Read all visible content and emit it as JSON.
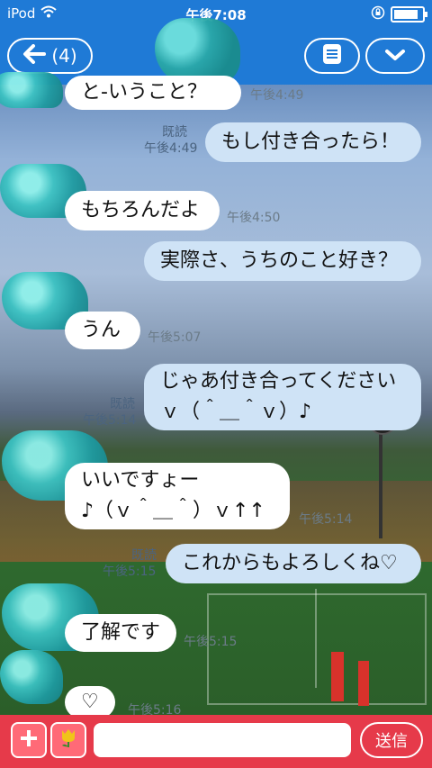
{
  "status": {
    "device": "iPod",
    "time": "午後7:08"
  },
  "header": {
    "back_count": "(4)"
  },
  "messages": [
    {
      "dir": "in",
      "text": "と-いうこと？",
      "time": "午後4:49",
      "read": ""
    },
    {
      "dir": "out",
      "text": "もし付き合ったら！",
      "time": "午後4:49",
      "read": "既読"
    },
    {
      "dir": "in",
      "text": "もちろんだよ",
      "time": "午後4:50",
      "read": ""
    },
    {
      "dir": "out",
      "text": "実際さ、うちのこと好き？",
      "time": "",
      "read": ""
    },
    {
      "dir": "in",
      "text": "うん",
      "time": "午後5:07",
      "read": ""
    },
    {
      "dir": "out",
      "text": "じゃあ付き合ってください\nｖ（＾＿＾ｖ）♪",
      "time": "午後5:14",
      "read": "既読"
    },
    {
      "dir": "in",
      "text": "いいですょー\n♪（ｖ＾＿＾）ｖ↑↑",
      "time": "午後5:14",
      "read": ""
    },
    {
      "dir": "out",
      "text": "これからもよろしくね♡",
      "time": "午後5:15",
      "read": "既読"
    },
    {
      "dir": "in",
      "text": "了解です",
      "time": "午後5:15",
      "read": ""
    },
    {
      "dir": "in",
      "text": "♡",
      "time": "午後5:16",
      "read": ""
    }
  ],
  "input": {
    "placeholder": "",
    "send_label": "送信"
  },
  "colors": {
    "header": "#1f7ad6",
    "inputbar": "#e63a4a",
    "out_bubble": "#cfe3f6"
  }
}
